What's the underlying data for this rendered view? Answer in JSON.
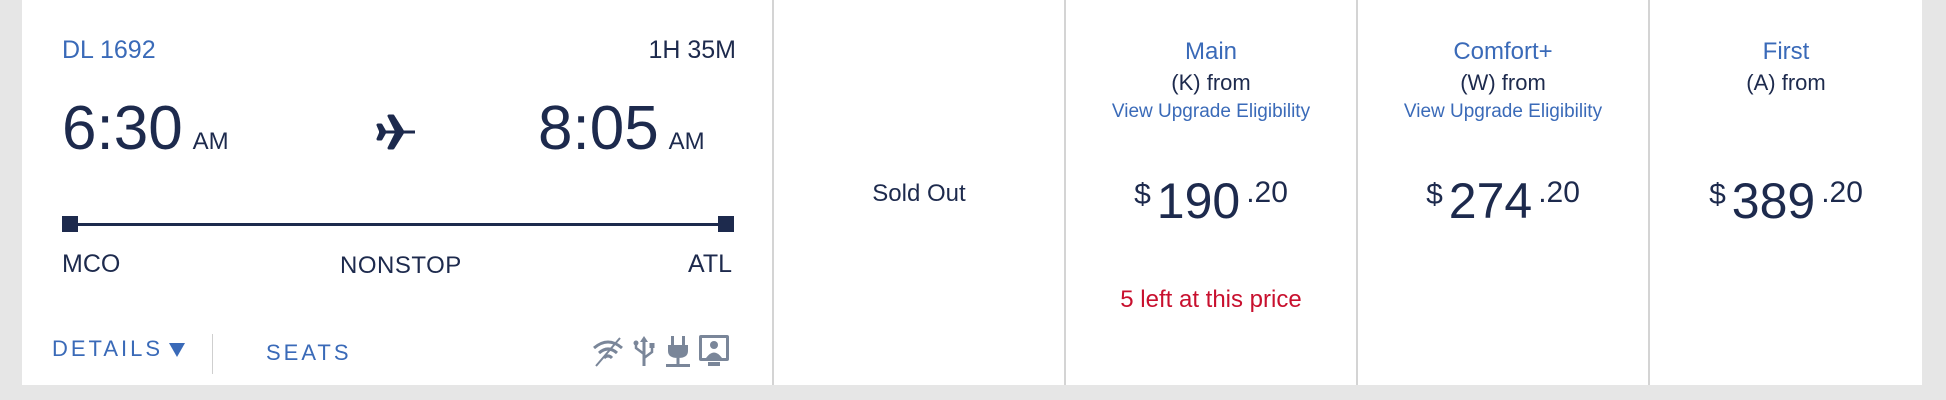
{
  "flight": {
    "number": "DL 1692",
    "duration": "1H 35M",
    "depart_time": "6:30",
    "depart_ampm": "AM",
    "arrive_time": "8:05",
    "arrive_ampm": "AM",
    "origin": "MCO",
    "destination": "ATL",
    "stops": "NONSTOP"
  },
  "actions": {
    "details_label": "DETAILS",
    "seats_label": "SEATS"
  },
  "amenities": [
    "wifi-icon",
    "usb-icon",
    "power-outlet-icon",
    "entertainment-screen-icon"
  ],
  "fares": {
    "basic": {
      "status": "Sold Out"
    },
    "main": {
      "cabin": "Main",
      "fare_class": "(K) from",
      "upgrade_link": "View Upgrade Eligibility",
      "currency": "$",
      "price_whole": "190",
      "price_cents": ".20",
      "availability": "5 left at this price"
    },
    "comfort": {
      "cabin": "Comfort+",
      "fare_class": "(W) from",
      "upgrade_link": "View Upgrade Eligibility",
      "currency": "$",
      "price_whole": "274",
      "price_cents": ".20"
    },
    "first": {
      "cabin": "First",
      "fare_class": "(A) from",
      "currency": "$",
      "price_whole": "389",
      "price_cents": ".20"
    }
  },
  "colors": {
    "navy": "#1d2a4d",
    "link_blue": "#3a6ab8",
    "alert_red": "#c8102e",
    "divider": "#d4d4d4"
  }
}
